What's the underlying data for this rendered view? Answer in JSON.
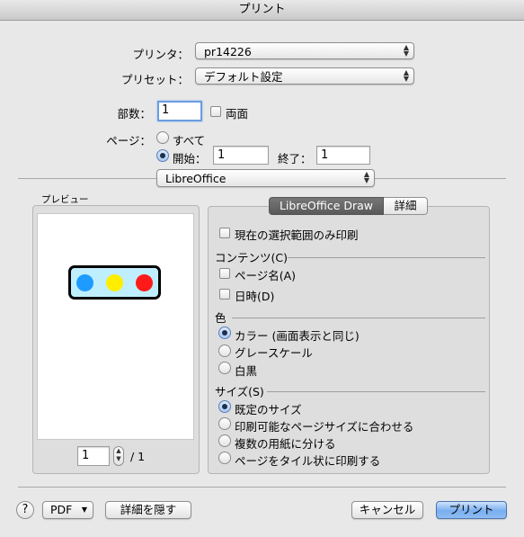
{
  "window": {
    "title": "プリント"
  },
  "printer": {
    "label": "プリンタ：",
    "value": "pr14226"
  },
  "preset": {
    "label": "プリセット：",
    "value": "デフォルト設定"
  },
  "copies": {
    "label": "部数：",
    "value": "1",
    "two_sided_label": "両面"
  },
  "pages": {
    "label": "ページ：",
    "all_label": "すべて",
    "from_label": "開始：",
    "from_value": "1",
    "to_label": "終了：",
    "to_value": "1"
  },
  "app_menu": {
    "value": "LibreOffice"
  },
  "preview": {
    "label": "プレビュー",
    "page_value": "1",
    "page_total": "/ 1",
    "dot_colors": [
      "#1e9bff",
      "#ffee00",
      "#ff1a1a"
    ],
    "bar_fill": "#bfefff"
  },
  "tabs": [
    "LibreOffice Draw",
    "詳細"
  ],
  "options": {
    "selection_only": "現在の選択範囲のみ印刷",
    "contents_title": "コンテンツ(C)",
    "page_name": "ページ名(A)",
    "date_time": "日時(D)",
    "color_title": "色",
    "color_options": [
      "カラー (画面表示と同じ)",
      "グレースケール",
      "白黒"
    ],
    "size_title": "サイズ(S)",
    "size_options": [
      "既定のサイズ",
      "印刷可能なページサイズに合わせる",
      "複数の用紙に分ける",
      "ページをタイル状に印刷する"
    ]
  },
  "footer": {
    "help": "?",
    "pdf": "PDF",
    "hide_details": "詳細を隠す",
    "cancel": "キャンセル",
    "print": "プリント"
  }
}
